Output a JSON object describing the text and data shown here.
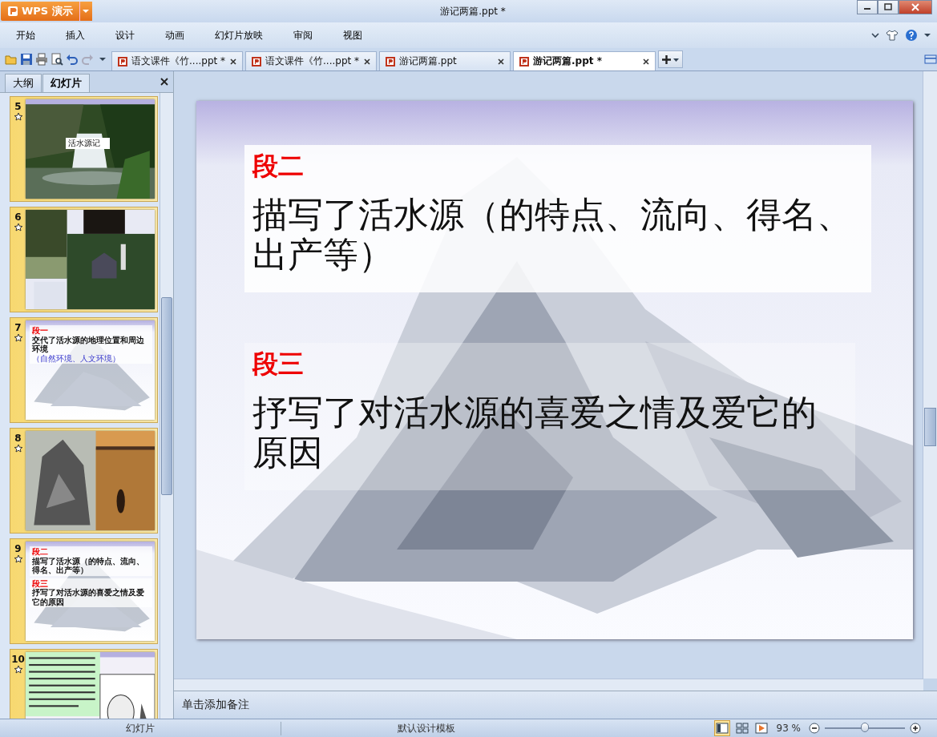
{
  "app": {
    "name": "WPS 演示"
  },
  "window": {
    "title": "游记两篇.ppt *"
  },
  "menu": [
    {
      "label": "开始"
    },
    {
      "label": "插入"
    },
    {
      "label": "设计"
    },
    {
      "label": "动画"
    },
    {
      "label": "幻灯片放映"
    },
    {
      "label": "审阅"
    },
    {
      "label": "视图"
    }
  ],
  "doc_tabs": [
    {
      "label": "语文课件《竹....ppt *",
      "selected": false
    },
    {
      "label": "语文课件《竹....ppt *",
      "selected": false
    },
    {
      "label": "游记两篇.ppt",
      "selected": false
    },
    {
      "label": "游记两篇.ppt *",
      "selected": true
    }
  ],
  "panel_tabs": [
    {
      "label": "大纲",
      "selected": false
    },
    {
      "label": "幻灯片",
      "selected": true
    }
  ],
  "slides": [
    {
      "number": "5",
      "kind": "waterfall",
      "caption": "活水源记"
    },
    {
      "number": "6",
      "kind": "temple"
    },
    {
      "number": "7",
      "kind": "text",
      "sections": [
        {
          "heading": "段一",
          "body": "交代了活水源的地理位置和周边环境",
          "note": "（自然环境、人文环境）"
        }
      ]
    },
    {
      "number": "8",
      "kind": "painting"
    },
    {
      "number": "9",
      "kind": "text",
      "sections": [
        {
          "heading": "段二",
          "body": "描写了活水源（的特点、流向、得名、出产等）"
        },
        {
          "heading": "段三",
          "body": "抒写了对活水源的喜爱之情及爱它的原因"
        }
      ]
    },
    {
      "number": "10",
      "kind": "portrait"
    }
  ],
  "current_slide": {
    "sections": [
      {
        "heading": "段二",
        "body": "描写了活水源（的特点、流向、得名、出产等）"
      },
      {
        "heading": "段三",
        "body": "抒写了对活水源的喜爱之情及爱它的原因"
      }
    ]
  },
  "notes": {
    "placeholder": "单击添加备注"
  },
  "status_bar": {
    "view": "幻灯片",
    "template": "默认设计模板",
    "zoom": "93 %",
    "level": 0.5
  }
}
